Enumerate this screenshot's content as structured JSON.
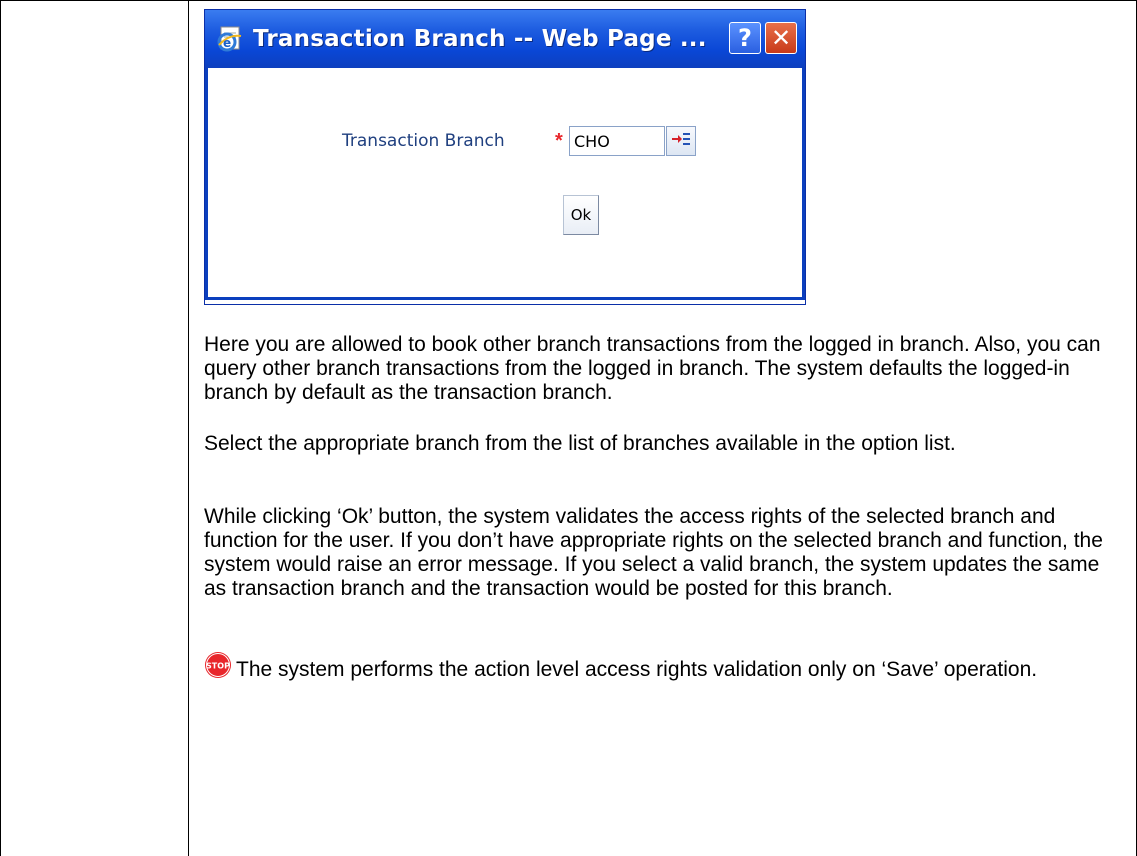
{
  "dialog": {
    "title": "Transaction Branch -- Web Page ...",
    "help_label": "?",
    "close_label": "✕",
    "field_label": "Transaction Branch",
    "required_marker": "*",
    "branch_value": "CHO",
    "ok_label": "Ok"
  },
  "paragraphs": {
    "p1": "Here you are allowed to book other branch transactions from the logged in branch. Also, you can query other branch transactions from the logged in branch. The system defaults the logged-in branch by default as the transaction branch.",
    "p2": "Select the appropriate branch from the list of branches available in the option list.",
    "p3": "While clicking ‘Ok’ button, the system validates the access rights of the selected branch and function for the user. If you don’t have appropriate rights on the selected branch and function, the system would raise an error message. If you select a valid branch, the system updates the same as transaction branch and the transaction would be posted for this branch.",
    "note_text": "The system performs the action level access rights validation only on ‘Save’ operation."
  },
  "note": {
    "icon": "stop-icon",
    "icon_text": "STOP"
  },
  "colors": {
    "titlebar": "#0a47d6",
    "label": "#1f3f7f",
    "required": "#e8262b",
    "stop": "#e8262b"
  }
}
